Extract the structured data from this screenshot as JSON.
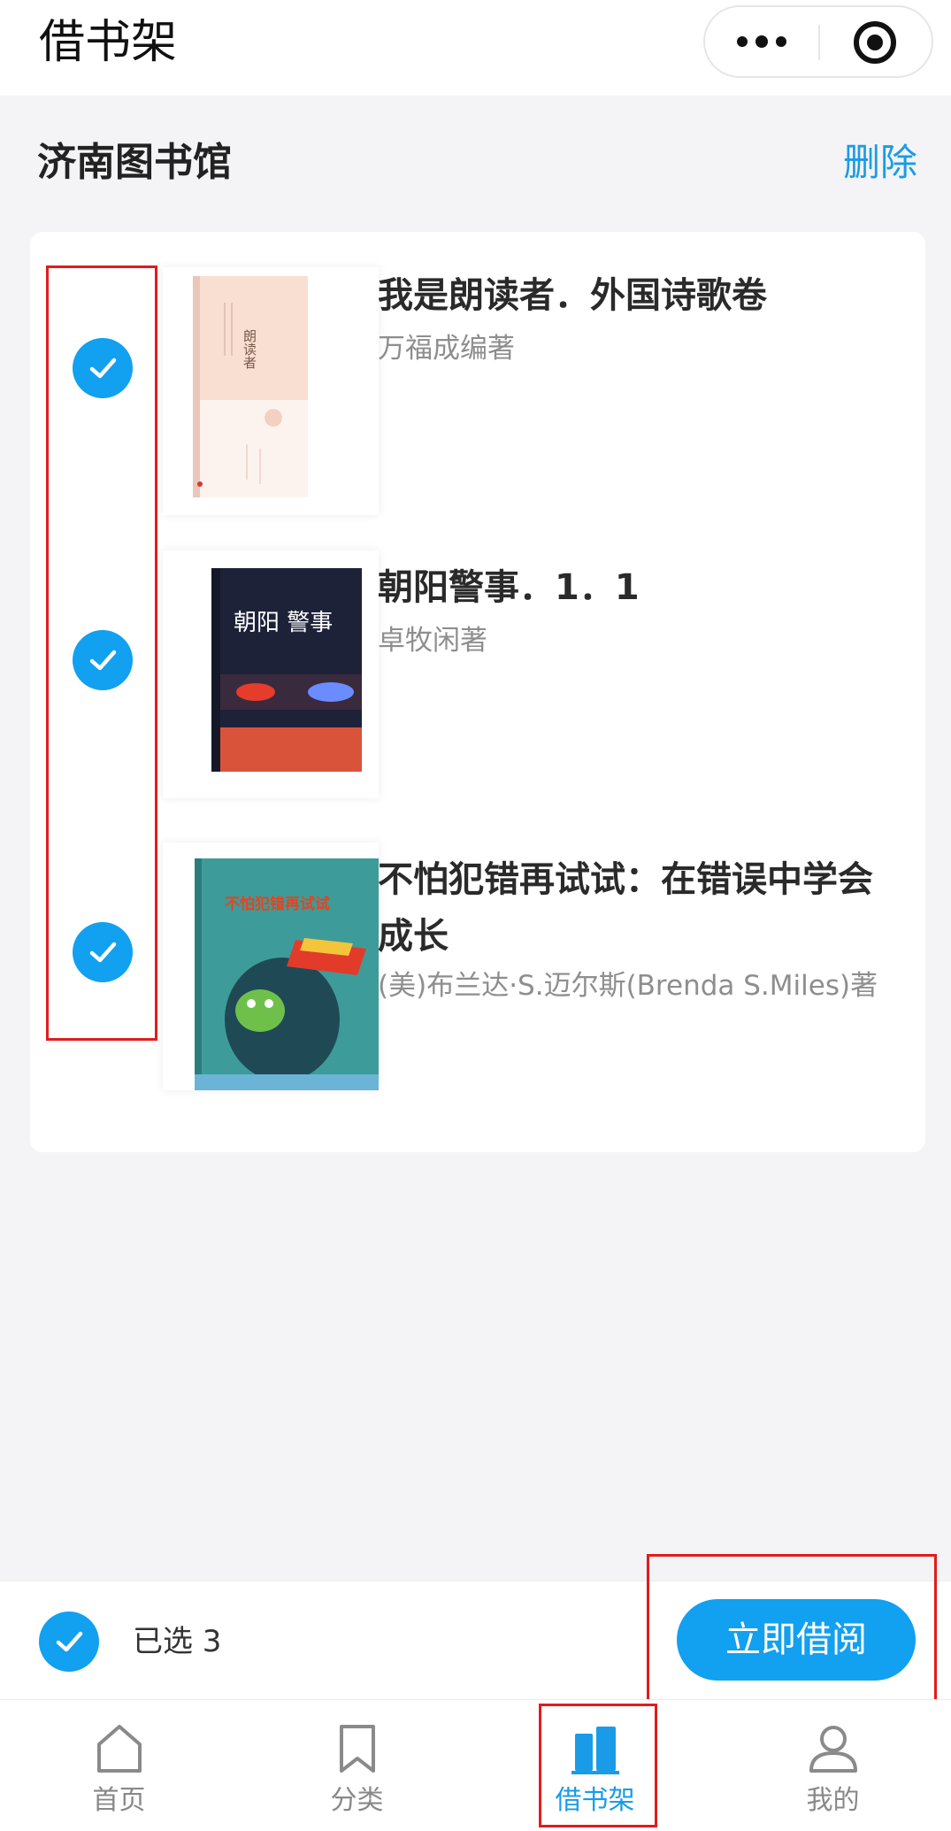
{
  "topbar": {
    "title": "借书架"
  },
  "library": {
    "name": "济南图书馆",
    "delete_label": "删除"
  },
  "books": [
    {
      "title": "我是朗读者．外国诗歌卷",
      "author": "万福成编著",
      "selected": true,
      "cover_text": "朗读者"
    },
    {
      "title": "朝阳警事．1．1",
      "author": "卓牧闲著",
      "selected": true,
      "cover_text": "朝阳 警事"
    },
    {
      "title": "不怕犯错再试试：在错误中学会成长",
      "author": "(美)布兰达·S.迈尔斯(Brenda S.Miles)著",
      "selected": true,
      "cover_text": "不怕犯错再试试"
    }
  ],
  "action_bar": {
    "selected_label": "已选 3",
    "borrow_label": "立即借阅"
  },
  "tabs": [
    {
      "label": "首页",
      "icon": "home-icon",
      "active": false
    },
    {
      "label": "分类",
      "icon": "bookmark-icon",
      "active": false
    },
    {
      "label": "借书架",
      "icon": "bookshelf-icon",
      "active": true
    },
    {
      "label": "我的",
      "icon": "user-icon",
      "active": false
    }
  ],
  "colors": {
    "accent": "#12a0f0",
    "link": "#1a9be8",
    "annotation": "#e11c1c",
    "background": "#f4f4f6"
  }
}
